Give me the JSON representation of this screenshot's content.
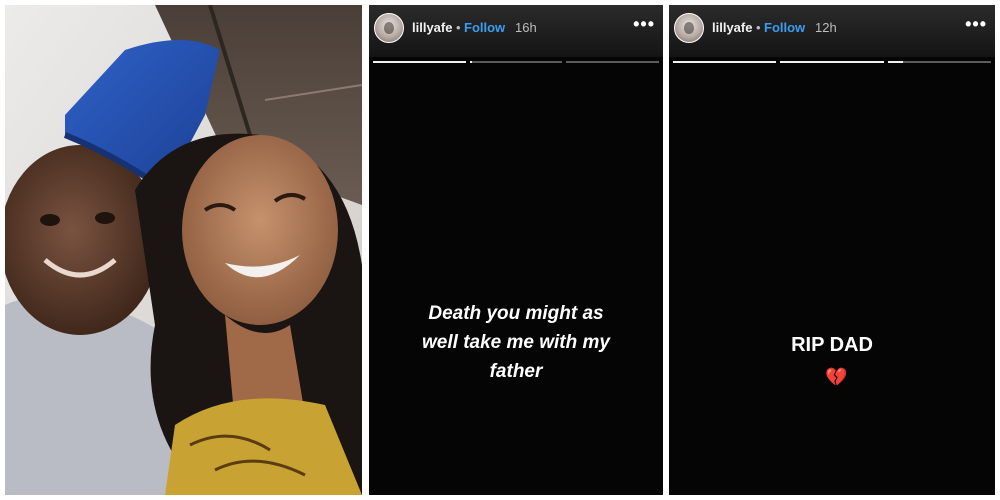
{
  "photo": {
    "alt": "father-and-daughter-selfie"
  },
  "stories": [
    {
      "username": "lillyafe",
      "dot": "•",
      "follow_label": "Follow",
      "time": "16h",
      "more": "•••",
      "progress": [
        1,
        0.02,
        0
      ],
      "text_lines": [
        "Death you might as",
        "well take me with my",
        "father"
      ]
    },
    {
      "username": "lillyafe",
      "dot": "•",
      "follow_label": "Follow",
      "time": "12h",
      "more": "•••",
      "progress": [
        1,
        1,
        0.15
      ],
      "text_lines": [
        "RIP DAD"
      ],
      "emoji": "💔"
    }
  ]
}
